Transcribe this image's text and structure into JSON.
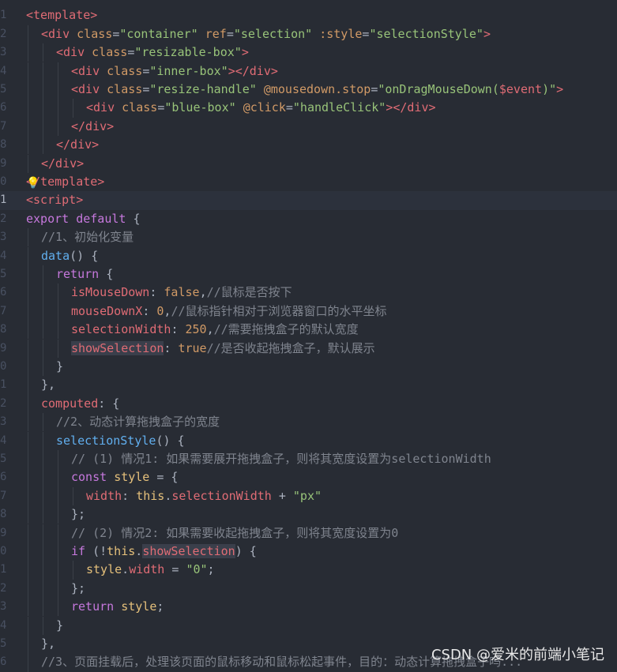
{
  "editor": {
    "lines": [
      {
        "n": "1",
        "indent": 0,
        "tokens": [
          [
            "tag",
            "<template>"
          ]
        ]
      },
      {
        "n": "2",
        "indent": 1,
        "tokens": [
          [
            "tag",
            "<div "
          ],
          [
            "attr",
            "class"
          ],
          [
            "punc",
            "="
          ],
          [
            "str",
            "\"container\""
          ],
          [
            "punc",
            " "
          ],
          [
            "attr",
            "ref"
          ],
          [
            "punc",
            "="
          ],
          [
            "str",
            "\"selection\""
          ],
          [
            "punc",
            " "
          ],
          [
            "attr",
            ":style"
          ],
          [
            "punc",
            "="
          ],
          [
            "str",
            "\"selectionStyle\""
          ],
          [
            "tag",
            ">"
          ]
        ]
      },
      {
        "n": "3",
        "indent": 2,
        "tokens": [
          [
            "tag",
            "<div "
          ],
          [
            "attr",
            "class"
          ],
          [
            "punc",
            "="
          ],
          [
            "str",
            "\"resizable-box\""
          ],
          [
            "tag",
            ">"
          ]
        ]
      },
      {
        "n": "4",
        "indent": 3,
        "tokens": [
          [
            "tag",
            "<div "
          ],
          [
            "attr",
            "class"
          ],
          [
            "punc",
            "="
          ],
          [
            "str",
            "\"inner-box\""
          ],
          [
            "tag",
            "></div>"
          ]
        ]
      },
      {
        "n": "5",
        "indent": 3,
        "tokens": [
          [
            "tag",
            "<div "
          ],
          [
            "attr",
            "class"
          ],
          [
            "punc",
            "="
          ],
          [
            "str",
            "\"resize-handle\""
          ],
          [
            "punc",
            " "
          ],
          [
            "attr",
            "@mousedown.stop"
          ],
          [
            "punc",
            "="
          ],
          [
            "str",
            "\"onDragMouseDown("
          ],
          [
            "tag",
            "$event"
          ],
          [
            "str",
            ")\""
          ],
          [
            "tag",
            ">"
          ]
        ]
      },
      {
        "n": "6",
        "indent": 4,
        "tokens": [
          [
            "tag",
            "<div "
          ],
          [
            "attr",
            "class"
          ],
          [
            "punc",
            "="
          ],
          [
            "str",
            "\"blue-box\""
          ],
          [
            "punc",
            " "
          ],
          [
            "attr",
            "@click"
          ],
          [
            "punc",
            "="
          ],
          [
            "str",
            "\"handleClick\""
          ],
          [
            "tag",
            "></div>"
          ]
        ]
      },
      {
        "n": "7",
        "indent": 3,
        "tokens": [
          [
            "tag",
            "</div>"
          ]
        ]
      },
      {
        "n": "8",
        "indent": 2,
        "tokens": [
          [
            "tag",
            "</div>"
          ]
        ]
      },
      {
        "n": "9",
        "indent": 1,
        "tokens": [
          [
            "tag",
            "</div>"
          ]
        ]
      },
      {
        "n": "0",
        "indent": 0,
        "tokens": [
          [
            "tag",
            "</template>"
          ]
        ],
        "bulb": "💡"
      },
      {
        "n": "1",
        "indent": 0,
        "tokens": [
          [
            "tag",
            "<script>"
          ]
        ],
        "active": true
      },
      {
        "n": "2",
        "indent": 0,
        "tokens": [
          [
            "kw",
            "export default "
          ],
          [
            "punc",
            "{"
          ]
        ]
      },
      {
        "n": "3",
        "indent": 1,
        "tokens": [
          [
            "cm",
            "//1、初始化变量"
          ]
        ]
      },
      {
        "n": "4",
        "indent": 1,
        "tokens": [
          [
            "fn",
            "data"
          ],
          [
            "punc",
            "() {"
          ]
        ]
      },
      {
        "n": "5",
        "indent": 2,
        "tokens": [
          [
            "kw",
            "return "
          ],
          [
            "punc",
            "{"
          ]
        ]
      },
      {
        "n": "6",
        "indent": 3,
        "tokens": [
          [
            "prop",
            "isMouseDown"
          ],
          [
            "punc",
            ": "
          ],
          [
            "num",
            "false"
          ],
          [
            "punc",
            ","
          ],
          [
            "cm",
            "//鼠标是否按下"
          ]
        ]
      },
      {
        "n": "7",
        "indent": 3,
        "tokens": [
          [
            "prop",
            "mouseDownX"
          ],
          [
            "punc",
            ": "
          ],
          [
            "num",
            "0"
          ],
          [
            "punc",
            ","
          ],
          [
            "cm",
            "//鼠标指针相对于浏览器窗口的水平坐标"
          ]
        ]
      },
      {
        "n": "8",
        "indent": 3,
        "tokens": [
          [
            "prop",
            "selectionWidth"
          ],
          [
            "punc",
            ": "
          ],
          [
            "num",
            "250"
          ],
          [
            "punc",
            ","
          ],
          [
            "cm",
            "//需要拖拽盒子的默认宽度"
          ]
        ]
      },
      {
        "n": "9",
        "indent": 3,
        "tokens": [
          [
            "prop hl",
            "showSelection"
          ],
          [
            "punc",
            ": "
          ],
          [
            "num",
            "true"
          ],
          [
            "cm",
            "//是否收起拖拽盒子，默认展示"
          ]
        ]
      },
      {
        "n": "0",
        "indent": 2,
        "tokens": [
          [
            "punc",
            "}"
          ]
        ]
      },
      {
        "n": "1",
        "indent": 1,
        "tokens": [
          [
            "punc",
            "},"
          ]
        ]
      },
      {
        "n": "2",
        "indent": 1,
        "tokens": [
          [
            "prop",
            "computed"
          ],
          [
            "punc",
            ": {"
          ]
        ]
      },
      {
        "n": "3",
        "indent": 2,
        "tokens": [
          [
            "cm",
            "//2、动态计算拖拽盒子的宽度"
          ]
        ]
      },
      {
        "n": "4",
        "indent": 2,
        "tokens": [
          [
            "fn",
            "selectionStyle"
          ],
          [
            "punc",
            "() {"
          ]
        ]
      },
      {
        "n": "5",
        "indent": 3,
        "tokens": [
          [
            "cm",
            "// (1) 情况1: 如果需要展开拖拽盒子，则将其宽度设置为selectionWidth"
          ]
        ]
      },
      {
        "n": "6",
        "indent": 3,
        "tokens": [
          [
            "kw",
            "const "
          ],
          [
            "var",
            "style"
          ],
          [
            "punc",
            " = {"
          ]
        ]
      },
      {
        "n": "7",
        "indent": 4,
        "tokens": [
          [
            "prop",
            "width"
          ],
          [
            "punc",
            ": "
          ],
          [
            "var",
            "this"
          ],
          [
            "punc",
            "."
          ],
          [
            "prop",
            "selectionWidth"
          ],
          [
            "punc",
            " + "
          ],
          [
            "str",
            "\"px\""
          ]
        ]
      },
      {
        "n": "8",
        "indent": 3,
        "tokens": [
          [
            "punc",
            "};"
          ]
        ]
      },
      {
        "n": "9",
        "indent": 3,
        "tokens": [
          [
            "cm",
            "// (2) 情况2: 如果需要收起拖拽盒子，则将其宽度设置为0"
          ]
        ]
      },
      {
        "n": "0",
        "indent": 3,
        "tokens": [
          [
            "kw",
            "if "
          ],
          [
            "punc",
            "(!"
          ],
          [
            "var",
            "this"
          ],
          [
            "punc",
            "."
          ],
          [
            "prop hl",
            "showSelection"
          ],
          [
            "punc",
            ") {"
          ]
        ]
      },
      {
        "n": "1",
        "indent": 4,
        "tokens": [
          [
            "var",
            "style"
          ],
          [
            "punc",
            "."
          ],
          [
            "prop",
            "width"
          ],
          [
            "punc",
            " = "
          ],
          [
            "str",
            "\"0\""
          ],
          [
            "punc",
            ";"
          ]
        ]
      },
      {
        "n": "2",
        "indent": 3,
        "tokens": [
          [
            "punc",
            "};"
          ]
        ]
      },
      {
        "n": "3",
        "indent": 3,
        "tokens": [
          [
            "kw",
            "return "
          ],
          [
            "var",
            "style"
          ],
          [
            "punc",
            ";"
          ]
        ]
      },
      {
        "n": "4",
        "indent": 2,
        "tokens": [
          [
            "punc",
            "}"
          ]
        ]
      },
      {
        "n": "5",
        "indent": 1,
        "tokens": [
          [
            "punc",
            "},"
          ]
        ]
      },
      {
        "n": "6",
        "indent": 1,
        "tokens": [
          [
            "cm",
            "//3、页面挂载后，处理该页面的鼠标移动和鼠标松起事件，目的：动态计算拖拽盒子吗..."
          ]
        ]
      }
    ]
  },
  "watermark": "CSDN @爱米的前端小笔记",
  "colors": {
    "background": "#282c34",
    "tag": "#e06c75",
    "attribute": "#d19a66",
    "string": "#98c379",
    "keyword": "#c678dd",
    "function": "#61afef",
    "comment": "#7f848e"
  }
}
